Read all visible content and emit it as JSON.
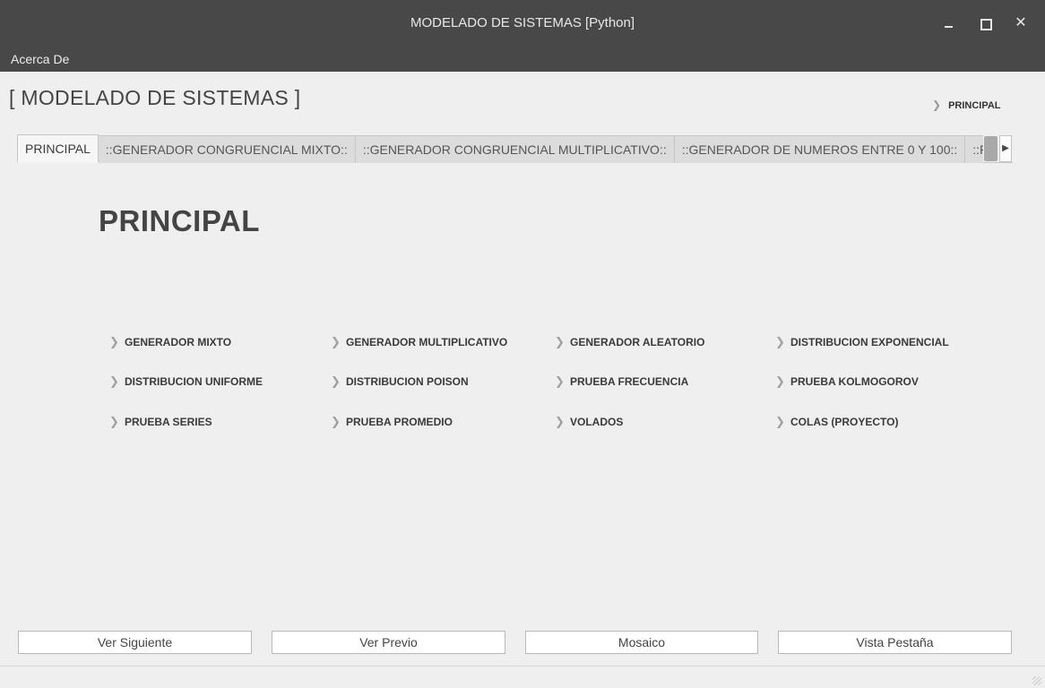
{
  "window": {
    "title": "MODELADO DE SISTEMAS [Python]",
    "close_glyph": "✕"
  },
  "menu": {
    "items": [
      {
        "label": "Acerca De"
      }
    ]
  },
  "header": {
    "title": "[ MODELADO DE SISTEMAS ]",
    "breadcrumb": "PRINCIPAL",
    "chevron": "❯"
  },
  "tabs": [
    {
      "label": "PRINCIPAL",
      "active": true
    },
    {
      "label": "::GENERADOR CONGRUENCIAL MIXTO::"
    },
    {
      "label": "::GENERADOR CONGRUENCIAL MULTIPLICATIVO::"
    },
    {
      "label": "::GENERADOR DE NUMEROS ENTRE 0 Y 100::"
    },
    {
      "label": "::PRUEBA FRECUENCIA::"
    }
  ],
  "tab_scroll_glyph": "▶",
  "main": {
    "title": "PRINCIPAL",
    "links": [
      "GENERADOR MIXTO",
      "GENERADOR MULTIPLICATIVO",
      "GENERADOR ALEATORIO",
      "DISTRIBUCION  EXPONENCIAL",
      "DISTRIBUCION UNIFORME",
      "DISTRIBUCION POISON",
      "PRUEBA FRECUENCIA",
      "PRUEBA KOLMOGOROV",
      "PRUEBA  SERIES",
      "PRUEBA PROMEDIO",
      "VOLADOS",
      "COLAS (PROYECTO)"
    ]
  },
  "footer": {
    "buttons": [
      "Ver Siguiente",
      "Ver Previo",
      "Mosaico",
      "Vista Pestaña"
    ]
  }
}
